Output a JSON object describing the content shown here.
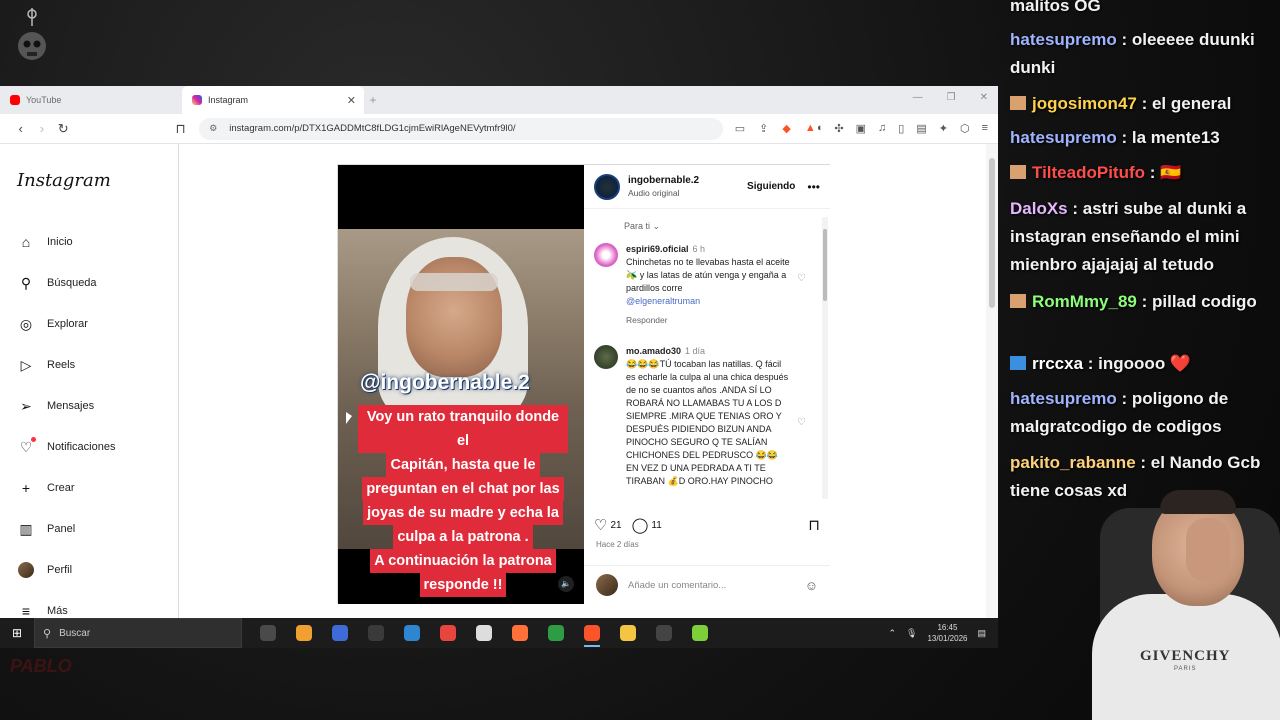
{
  "browser": {
    "tabs": [
      {
        "label": "YouTube",
        "fav_color": "#ff0000"
      },
      {
        "label": "Instagram",
        "fav_color": "#d6249f"
      }
    ],
    "url": "instagram.com/p/DTX1GADDMtC8fLDG1cjmEwiRlAgeNEVytmfr9l0/"
  },
  "instagram": {
    "logo": "Instagram",
    "nav": [
      {
        "label": "Inicio",
        "icon": "home-icon",
        "glyph": "⌂"
      },
      {
        "label": "Búsqueda",
        "icon": "search-icon",
        "glyph": "⚲"
      },
      {
        "label": "Explorar",
        "icon": "compass-icon",
        "glyph": "◎"
      },
      {
        "label": "Reels",
        "icon": "reels-icon",
        "glyph": "▷"
      },
      {
        "label": "Mensajes",
        "icon": "messages-icon",
        "glyph": "➢"
      },
      {
        "label": "Notificaciones",
        "icon": "heart-icon",
        "glyph": "♡"
      },
      {
        "label": "Crear",
        "icon": "plus-icon",
        "glyph": "+"
      },
      {
        "label": "Panel",
        "icon": "chart-icon",
        "glyph": "▥"
      },
      {
        "label": "Perfil",
        "icon": "avatar-icon",
        "glyph": ""
      },
      {
        "label": "Más",
        "icon": "menu-icon",
        "glyph": "≡"
      }
    ],
    "post": {
      "video_handle": "@ingobernable.2",
      "video_caption": [
        "Voy un rato tranquilo donde el",
        "Capitán, hasta que le",
        "preguntan en el chat por las",
        "joyas de su madre y echa la",
        "culpa a la patrona .",
        "A continuación la patrona",
        "responde !!"
      ],
      "author": "ingobernable.2",
      "audio": "Audio original",
      "follow_label": "Siguiendo",
      "sort_label": "Para ti",
      "comments": [
        {
          "user": "espiri69.oficial",
          "time": "6 h",
          "text": "Chinchetas no te llevabas hasta el aceite 🫒 y las latas de atún venga y engaña a pardillos corre",
          "mention": "@elgeneraltruman",
          "reply": "Responder"
        },
        {
          "user": "mo.amado30",
          "time": "1 día",
          "text": "😂😂😂TÚ tocaban las natillas. Q fácil es echarle la culpa al una chica después de no se cuantos años .ANDA SÍ LO ROBARÁ NO LLAMABAS TU A LOS D SIEMPRE .MIRA QUE TENIAS ORO Y DESPUÉS PIDIENDO BIZUN ANDA PINOCHO SEGURO Q TE SALÍAN CHICHONES DEL PEDRUSCO 😂😂 EN VEZ D UNA PEDRADA A TI TE TIRABAN 💰D ORO.HAY PINOCHO"
        }
      ],
      "likes": "21",
      "comment_count": "11",
      "posted": "Hace 2 días",
      "add_comment_placeholder": "Añade un comentario..."
    }
  },
  "taskbar": {
    "search_placeholder": "Buscar",
    "time": "16:45",
    "date": "13/01/2026",
    "apps": [
      "#4a4a4a",
      "#f0a030",
      "#3f6bd8",
      "#3a3a3a",
      "#2f86d0",
      "#e8453c",
      "#dddddd",
      "#ff7139",
      "#2e9c45",
      "#fb542b",
      "#f4c542",
      "#444444",
      "#7cd13a"
    ]
  },
  "chat": [
    {
      "user": "",
      "color": "#f2f2f2",
      "text": "malitos OG"
    },
    {
      "user": "hatesupremo",
      "color": "#9fb4ff",
      "text": "oleeeee duunki dunki"
    },
    {
      "user": "jogosimon47",
      "color": "#ffd24a",
      "text": "el general",
      "badge": "#d9a070"
    },
    {
      "user": "hatesupremo",
      "color": "#9fb4ff",
      "text": "la mente13"
    },
    {
      "user": "TilteadoPitufo",
      "color": "#ff4d4d",
      "text": "🇪🇸",
      "badge": "#d9a070"
    },
    {
      "user": "DaloXs",
      "color": "#e6b8ff",
      "text": "astri sube al dunki a instagran enseñando el mini mienbro ajajajaj al tetudo"
    },
    {
      "user": "RomMmy_89",
      "color": "#8cff7a",
      "text": "pillad codigo",
      "badge": "#d9a070"
    },
    {
      "user": "rrccxa",
      "color": "#ffffff",
      "text": "ingoooo ❤️",
      "badge": "#3a8fe0"
    },
    {
      "user": "hatesupremo",
      "color": "#9fb4ff",
      "text": "poligono de malgratcodigo de codigos"
    },
    {
      "user": "pakito_rabanne",
      "color": "#ffd27a",
      "text": "el Nando Gcb tiene cosas xd"
    }
  ],
  "webcam": {
    "brand": "GIVENCHY",
    "brand_sub": "PARIS"
  },
  "watermark": "PABLO"
}
